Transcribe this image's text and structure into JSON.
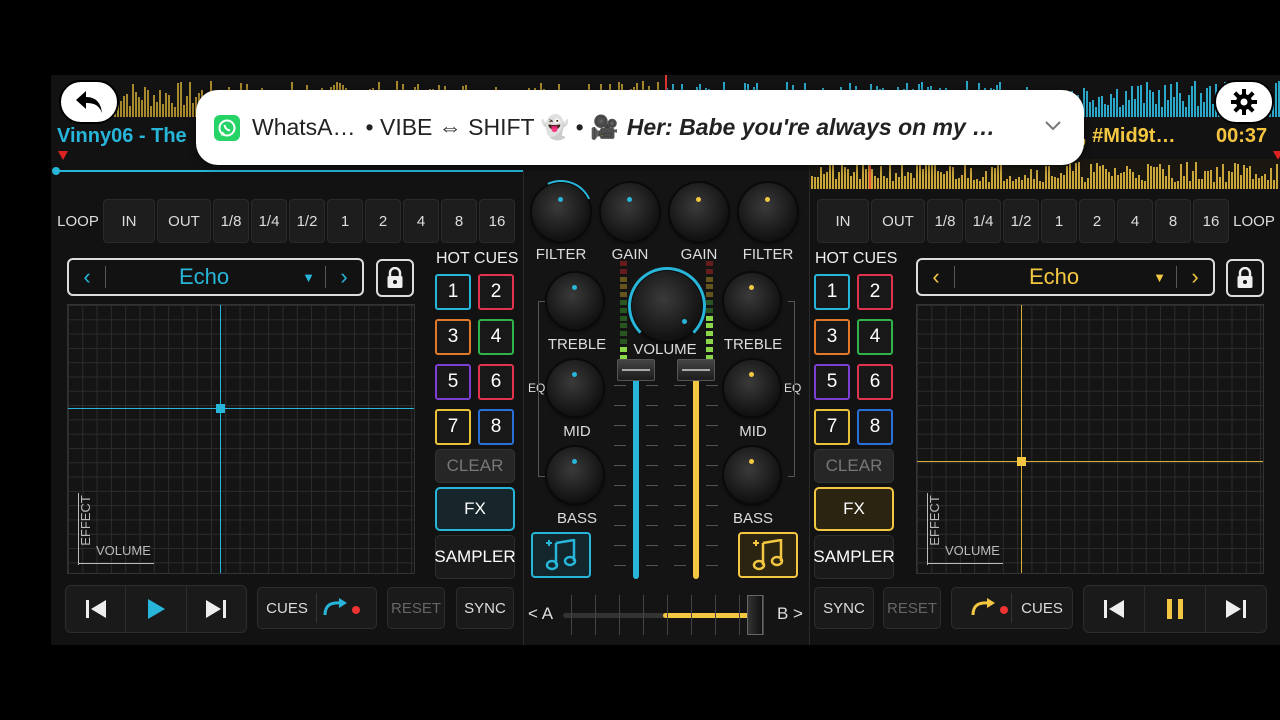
{
  "colors": {
    "deck_a": "#27b6d9",
    "deck_b": "#f3c742",
    "bg": "#121212"
  },
  "notification": {
    "app_icon": "whatsapp-icon",
    "app_name": "WhatsA…",
    "group": "• VIBE ⇔ SHIFT 👻 • 🎥",
    "message": "Her: Babe you're always on my …",
    "expand_icon": "chevron-down-icon"
  },
  "deck_a": {
    "title": "Vinny06 - The",
    "loop_buttons": [
      "LOOP",
      "IN",
      "OUT",
      "1/8",
      "1/4",
      "1/2",
      "1",
      "2",
      "4",
      "8",
      "16"
    ],
    "effect": "Echo",
    "pad_x_label": "VOLUME",
    "pad_y_label": "EFFECT",
    "hot_cues_title": "HOT CUES",
    "cues": [
      "1",
      "2",
      "3",
      "4",
      "5",
      "6",
      "7",
      "8"
    ],
    "clear": "CLEAR",
    "fx": "FX",
    "sampler": "SAMPLER",
    "cues_btn": "CUES",
    "reset": "RESET",
    "sync": "SYNC"
  },
  "deck_b": {
    "title": ", #Mid9t…",
    "time": "00:37",
    "loop_buttons": [
      "IN",
      "OUT",
      "1/8",
      "1/4",
      "1/2",
      "1",
      "2",
      "4",
      "8",
      "16",
      "LOOP"
    ],
    "effect": "Echo",
    "pad_x_label": "VOLUME",
    "pad_y_label": "EFFECT",
    "hot_cues_title": "HOT CUES",
    "cues": [
      "1",
      "2",
      "3",
      "4",
      "5",
      "6",
      "7",
      "8"
    ],
    "clear": "CLEAR",
    "fx": "FX",
    "sampler": "SAMPLER",
    "cues_btn": "CUES",
    "reset": "RESET",
    "sync": "SYNC"
  },
  "mixer": {
    "filter": "FILTER",
    "gain": "GAIN",
    "treble": "TREBLE",
    "volume": "VOLUME",
    "mid": "MID",
    "bass": "BASS",
    "eq": "EQ",
    "crossfader_a": "< A",
    "crossfader_b": "B >"
  }
}
